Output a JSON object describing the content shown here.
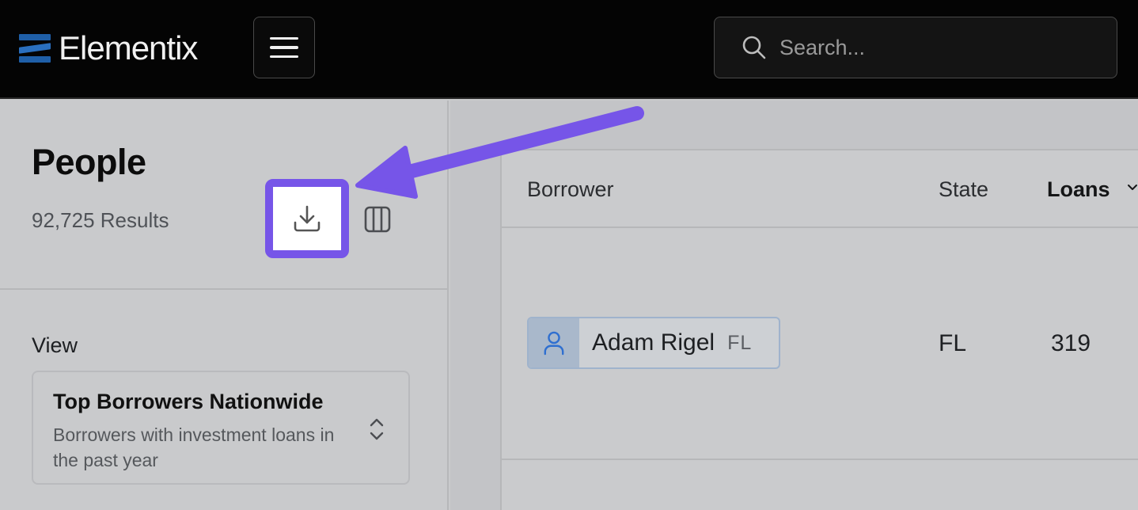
{
  "app": {
    "name": "Elementix",
    "brand_color": "#1f5fa8"
  },
  "header": {
    "search_placeholder": "Search...",
    "menu_icon": "hamburger-menu-icon",
    "search_icon": "search-icon"
  },
  "page": {
    "title": "People",
    "results": "92,725 Results"
  },
  "toolbar": {
    "download_icon": "download-icon",
    "columns_icon": "columns-icon",
    "highlight_color": "#7655e8"
  },
  "view": {
    "label": "View",
    "selected_name": "Top Borrowers Nationwide",
    "selected_description": "Borrowers with investment loans in the past year"
  },
  "table": {
    "columns": [
      "Borrower",
      "State",
      "Loans"
    ],
    "sorted_column": "Loans",
    "rows": [
      {
        "borrower": "Adam Rigel",
        "borrower_state": "FL",
        "state": "FL",
        "loans": "319"
      }
    ]
  }
}
